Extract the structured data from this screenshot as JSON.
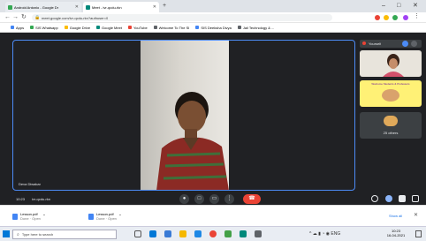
{
  "browser": {
    "tabs": [
      {
        "label": "Android Antonio - Google Dr",
        "active": false,
        "color": "#34a853"
      },
      {
        "label": "Meet - ivr-qcdu-rkn",
        "active": true,
        "color": "#00897b"
      }
    ],
    "new_tab": "+",
    "window_controls": {
      "minimize": "–",
      "maximize": "□",
      "close": "✕"
    },
    "url": "meet.google.com/ivr-qcdu-rkn?authuser=0",
    "bookmarks": [
      {
        "label": "Apps",
        "color": "#4285f4"
      },
      {
        "label": "SIS Whatsapp",
        "color": "#34a853"
      },
      {
        "label": "Google Drive",
        "color": "#fbbc04"
      },
      {
        "label": "Google Meet",
        "color": "#00897b"
      },
      {
        "label": "YouTube",
        "color": "#ea4335"
      },
      {
        "label": "Welcome To The SI",
        "color": "#5f6368"
      },
      {
        "label": "SIS Deeksha Divya",
        "color": "#4285f4"
      },
      {
        "label": "Jail Technology & ...",
        "color": "#5f6368"
      }
    ]
  },
  "meet": {
    "speaker_name": "Deva Diwakar",
    "meeting_time": "10:23",
    "meeting_code": "ivr-qcdu-rkn",
    "sidebar_header": "Yourself",
    "participant_tile_label": "25 others",
    "presentation_title": "Welcome Students & Professors",
    "controls": {
      "mic": "●",
      "camera": "□",
      "captions": "▭",
      "more": "⋮",
      "leave": "☎"
    },
    "colors": {
      "accent": "#4c8bf5",
      "leave": "#ea4335",
      "background": "#202124",
      "slide": "#fff176"
    }
  },
  "downloads": {
    "items": [
      {
        "name": "Lesson.pdf",
        "status": "Done · Open"
      },
      {
        "name": "Lesson.pdf",
        "status": "Done · Open"
      }
    ],
    "show_all": "Show all"
  },
  "taskbar": {
    "search_placeholder": "Type here to search",
    "time": "10:23",
    "date": "16-04-2021"
  }
}
